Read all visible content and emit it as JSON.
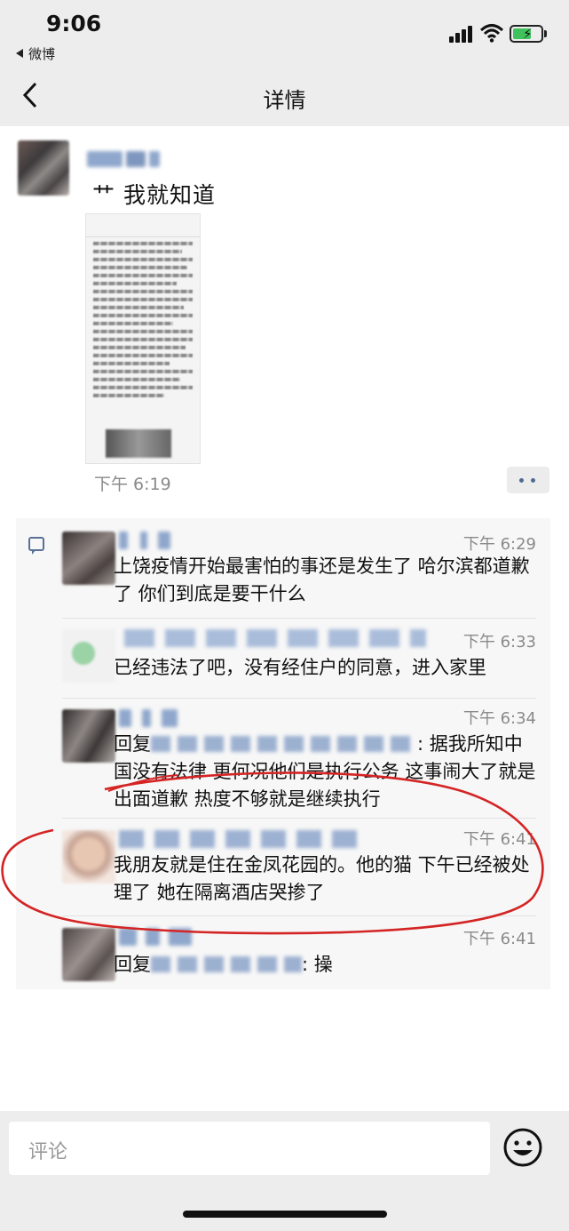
{
  "status_bar": {
    "time": "9:06",
    "back_app": "微博"
  },
  "nav": {
    "title": "详情"
  },
  "post": {
    "text": "艹 我就知道",
    "time": "下午 6:19"
  },
  "comments": [
    {
      "time": "下午 6:29",
      "text": "上饶疫情开始最害怕的事还是发生了 哈尔滨都道歉了 你们到底是要干什么"
    },
    {
      "time": "下午 6:33",
      "text": "已经违法了吧，没有经住户的同意，进入家里"
    },
    {
      "time": "下午 6:34",
      "reply_prefix": "回复",
      "text": ": 据我所知中国没有法律 更何况他们是执行公务 这事闹大了就是出面道歉 热度不够就是继续执行"
    },
    {
      "time": "下午 6:41",
      "text": "我朋友就是住在金凤花园的。他的猫 下午已经被处理了 她在隔离酒店哭掺了"
    },
    {
      "time": "下午 6:41",
      "reply_prefix": "回复",
      "text": ": 操"
    }
  ],
  "input": {
    "placeholder": "评论"
  },
  "colors": {
    "background": "#ededed",
    "comment_bg": "#f7f7f7",
    "name_blue": "#5a7197",
    "annotation_red": "#d42424"
  },
  "icons": [
    "back-arrow-icon",
    "signal-icon",
    "wifi-icon",
    "battery-icon",
    "comment-icon",
    "more-dots-icon",
    "emoji-icon"
  ]
}
